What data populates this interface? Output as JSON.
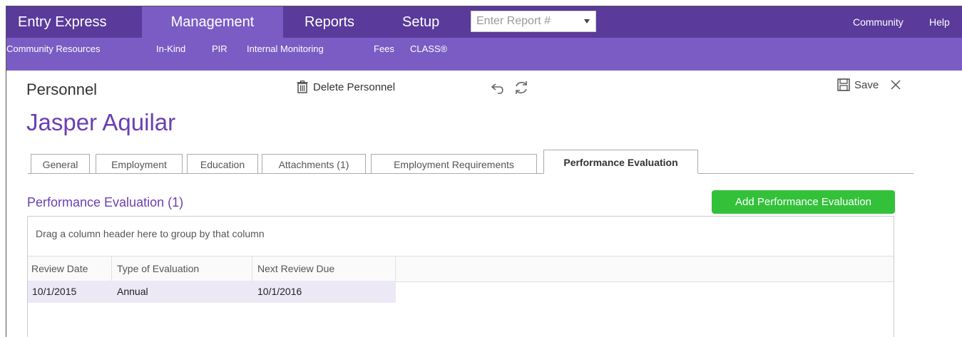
{
  "topnav": {
    "tabs": [
      "Entry Express",
      "Management",
      "Reports",
      "Setup"
    ],
    "active_tab": "Management",
    "report_placeholder": "Enter Report #",
    "links": [
      "Community",
      "Help"
    ]
  },
  "subnav": {
    "items": [
      "Community Resources",
      "In-Kind",
      "PIR",
      "Internal Monitoring",
      "Fees",
      "CLASS®"
    ]
  },
  "header": {
    "section_title": "Personnel",
    "delete_label": "Delete Personnel",
    "save_label": "Save",
    "person_name": "Jasper Aquilar"
  },
  "tabs": [
    "General",
    "Employment",
    "Education",
    "Attachments (1)",
    "Employment Requirements",
    "Performance Evaluation"
  ],
  "active_tab": "Performance Evaluation",
  "performance": {
    "title": "Performance Evaluation (1)",
    "add_button": "Add Performance Evaluation",
    "group_hint": "Drag a column header here to group by that column",
    "columns": [
      "Review Date",
      "Type of Evaluation",
      "Next Review Due"
    ],
    "rows": [
      [
        "10/1/2015",
        "Annual",
        "10/1/2016"
      ]
    ]
  },
  "colors": {
    "topnav_bg": "#5a3a9a",
    "subnav_bg": "#7b5cc4",
    "accent_text": "#6a3fb0",
    "add_button_bg": "#33c13a"
  },
  "icons": [
    "trash-icon",
    "undo-icon",
    "refresh-icon",
    "save-icon",
    "close-icon",
    "dropdown-caret-icon"
  ]
}
